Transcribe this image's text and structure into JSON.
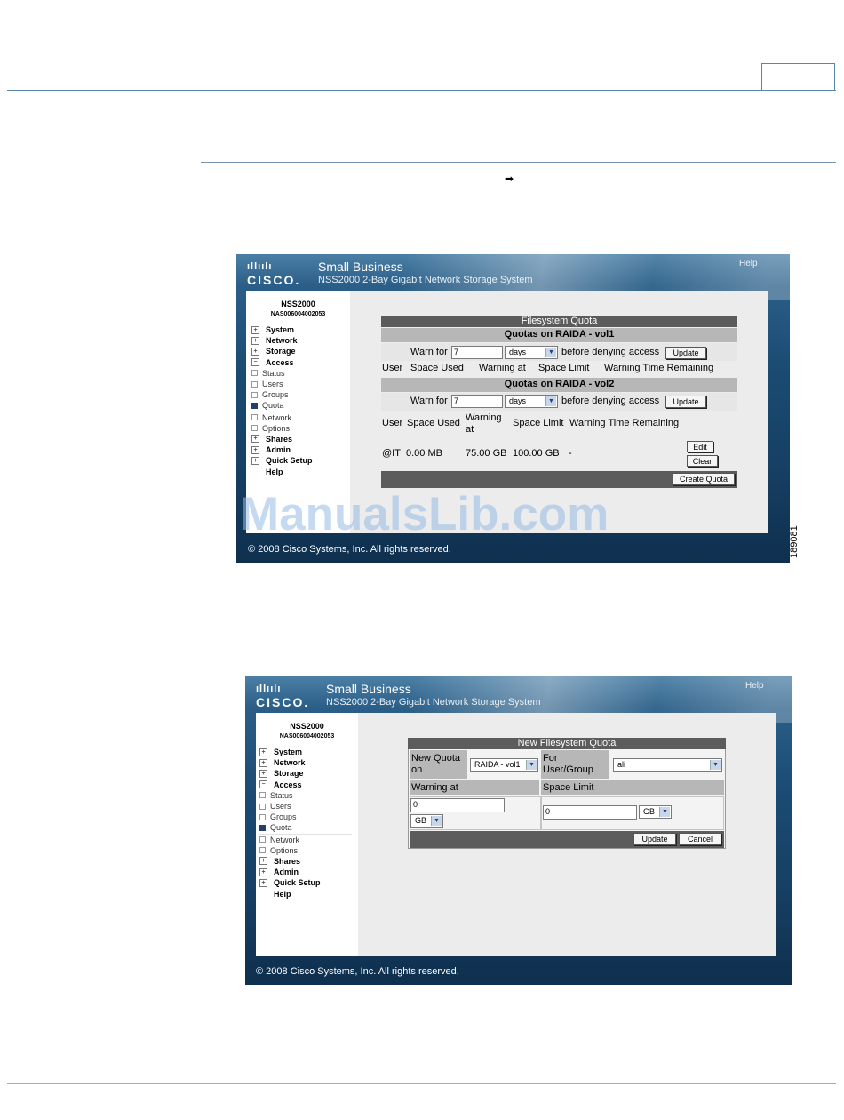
{
  "page": {
    "arrow_glyph": "➡"
  },
  "shot1": {
    "logo_bars": "ıllıılı",
    "logo_word": "CISCO.",
    "brand": "Small Business",
    "subtitle": "NSS2000 2-Bay Gigabit Network Storage System",
    "help": "Help",
    "device_name": "NSS2000",
    "device_serial": "NAS006004002053",
    "nav": [
      {
        "label": "System",
        "type": "top"
      },
      {
        "label": "Network",
        "type": "top"
      },
      {
        "label": "Storage",
        "type": "top"
      },
      {
        "label": "Access",
        "type": "top",
        "expanded": true
      },
      {
        "label": "Status",
        "type": "sub"
      },
      {
        "label": "Users",
        "type": "sub"
      },
      {
        "label": "Groups",
        "type": "sub"
      },
      {
        "label": "Quota",
        "type": "sub",
        "active": true
      },
      {
        "label": "Network",
        "type": "sub"
      },
      {
        "label": "Options",
        "type": "sub"
      },
      {
        "label": "Shares",
        "type": "top"
      },
      {
        "label": "Admin",
        "type": "top"
      },
      {
        "label": "Quick Setup",
        "type": "top"
      },
      {
        "label": "Help",
        "type": "plain"
      }
    ],
    "quota": {
      "title": "Filesystem Quota",
      "vol1_header": "Quotas on RAIDA - vol1",
      "vol2_header": "Quotas on RAIDA - vol2",
      "warn_for": "Warn for",
      "warn_value": "7",
      "unit": "days",
      "before_denying": "before denying access",
      "update": "Update",
      "cols1": [
        "User",
        "Space Used",
        "Warning at",
        "Space Limit",
        "Warning Time Remaining"
      ],
      "cols2": [
        "User",
        "Space Used",
        "Warning at",
        "Space Limit",
        "Warning Time Remaining"
      ],
      "row": {
        "user": "@IT",
        "used": "0.00 MB",
        "warning": "75.00 GB",
        "limit": "100.00 GB",
        "remaining": "-"
      },
      "edit": "Edit",
      "clear": "Clear",
      "create": "Create Quota"
    },
    "footer": "© 2008 Cisco Systems, Inc. All rights reserved."
  },
  "watermark": "ManualsLib.com",
  "figure_id": "189081",
  "shot2": {
    "logo_bars": "ıllıılı",
    "logo_word": "CISCO.",
    "brand": "Small Business",
    "subtitle": "NSS2000 2-Bay Gigabit Network Storage System",
    "help": "Help",
    "device_name": "NSS2000",
    "device_serial": "NAS006004002053",
    "nav": [
      {
        "label": "System",
        "type": "top"
      },
      {
        "label": "Network",
        "type": "top"
      },
      {
        "label": "Storage",
        "type": "top"
      },
      {
        "label": "Access",
        "type": "top",
        "expanded": true
      },
      {
        "label": "Status",
        "type": "sub"
      },
      {
        "label": "Users",
        "type": "sub"
      },
      {
        "label": "Groups",
        "type": "sub"
      },
      {
        "label": "Quota",
        "type": "sub",
        "active": true
      },
      {
        "label": "Network",
        "type": "sub"
      },
      {
        "label": "Options",
        "type": "sub"
      },
      {
        "label": "Shares",
        "type": "top"
      },
      {
        "label": "Admin",
        "type": "top"
      },
      {
        "label": "Quick Setup",
        "type": "top"
      },
      {
        "label": "Help",
        "type": "plain"
      }
    ],
    "new_quota": {
      "title": "New Filesystem Quota",
      "new_quota_on": "New Quota on",
      "volume": "RAIDA - vol1",
      "for_user_group": "For User/Group",
      "user_group": "ali",
      "warning_at": "Warning at",
      "space_limit": "Space Limit",
      "warning_value": "0",
      "warning_unit": "GB",
      "limit_value": "0",
      "limit_unit": "GB",
      "update": "Update",
      "cancel": "Cancel"
    },
    "footer": "© 2008 Cisco Systems, Inc. All rights reserved."
  }
}
